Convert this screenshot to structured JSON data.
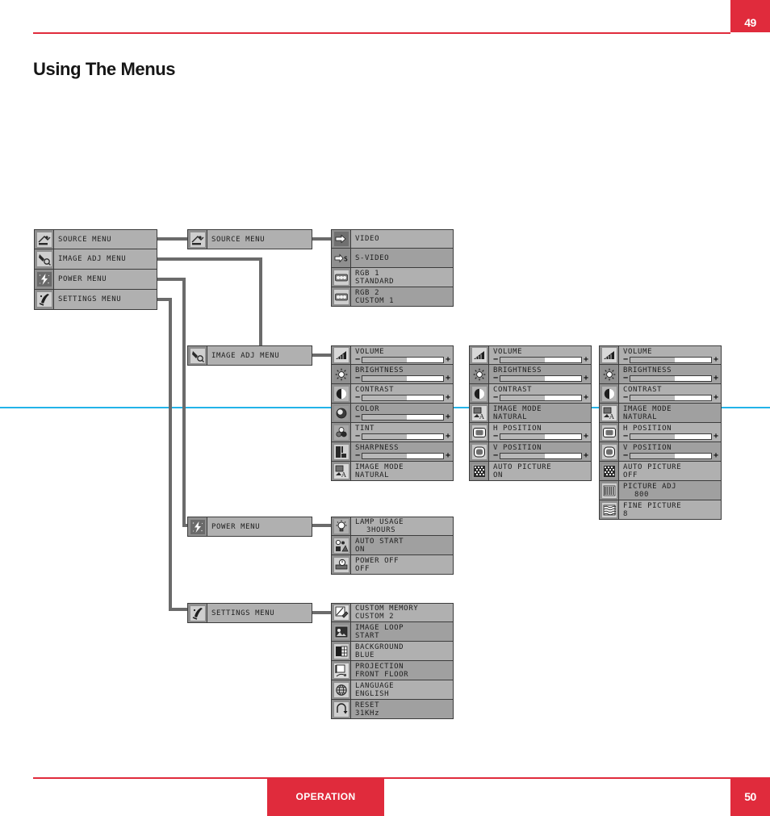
{
  "page": {
    "title": "Using The Menus",
    "page_number_top": "49",
    "page_number_bottom": "50",
    "footer_tab": "OPERATION",
    "accent_color": "#e02b3c",
    "rule_color": "#e02b3c",
    "cyan_line_color": "#22b3e8"
  },
  "diagram": {
    "root_menu": {
      "name": "main-menu",
      "items": [
        {
          "label": "SOURCE MENU",
          "icon": "source-icon"
        },
        {
          "label": "IMAGE ADJ MENU",
          "icon": "image-adj-icon"
        },
        {
          "label": "POWER MENU",
          "icon": "power-icon"
        },
        {
          "label": "SETTINGS MENU",
          "icon": "settings-icon"
        }
      ]
    },
    "source_menu": {
      "header": {
        "label": "SOURCE MENU",
        "icon": "source-icon"
      },
      "items": [
        {
          "label": "VIDEO",
          "value": "",
          "icon": "arrow-in-icon"
        },
        {
          "label": "S-VIDEO",
          "value": "",
          "icon": "arrow-s-icon"
        },
        {
          "label": "RGB 1",
          "value": "STANDARD",
          "icon": "rgb-dots-icon"
        },
        {
          "label": "RGB 2",
          "value": "CUSTOM 1",
          "icon": "rgb-dots-icon"
        }
      ]
    },
    "image_adj_menu": {
      "header": {
        "label": "IMAGE ADJ MENU",
        "icon": "image-adj-icon"
      },
      "video_items": [
        {
          "label": "VOLUME",
          "type": "slider",
          "fill": 55,
          "icon": "volume-icon"
        },
        {
          "label": "BRIGHTNESS",
          "type": "slider",
          "fill": 55,
          "icon": "brightness-icon"
        },
        {
          "label": "CONTRAST",
          "type": "slider",
          "fill": 55,
          "icon": "contrast-icon"
        },
        {
          "label": "COLOR",
          "type": "slider",
          "fill": 55,
          "icon": "color-icon"
        },
        {
          "label": "TINT",
          "type": "slider",
          "fill": 55,
          "icon": "tint-icon"
        },
        {
          "label": "SHARPNESS",
          "type": "slider",
          "fill": 55,
          "icon": "sharpness-icon"
        },
        {
          "label": "IMAGE MODE",
          "type": "value",
          "value": "NATURAL",
          "icon": "image-mode-icon"
        }
      ],
      "rgb_auto_items": [
        {
          "label": "VOLUME",
          "type": "slider",
          "fill": 55,
          "icon": "volume-icon"
        },
        {
          "label": "BRIGHTNESS",
          "type": "slider",
          "fill": 55,
          "icon": "brightness-icon"
        },
        {
          "label": "CONTRAST",
          "type": "slider",
          "fill": 55,
          "icon": "contrast-icon"
        },
        {
          "label": "IMAGE MODE",
          "type": "value",
          "value": "NATURAL",
          "icon": "image-mode-icon"
        },
        {
          "label": "H POSITION",
          "type": "slider",
          "fill": 55,
          "icon": "h-position-icon"
        },
        {
          "label": "V POSITION",
          "type": "slider",
          "fill": 55,
          "icon": "v-position-icon"
        },
        {
          "label": "AUTO PICTURE",
          "type": "value",
          "value": "ON",
          "icon": "auto-picture-icon"
        }
      ],
      "rgb_manual_items": [
        {
          "label": "VOLUME",
          "type": "slider",
          "fill": 55,
          "icon": "volume-icon"
        },
        {
          "label": "BRIGHTNESS",
          "type": "slider",
          "fill": 55,
          "icon": "brightness-icon"
        },
        {
          "label": "CONTRAST",
          "type": "slider",
          "fill": 55,
          "icon": "contrast-icon"
        },
        {
          "label": "IMAGE MODE",
          "type": "value",
          "value": "NATURAL",
          "icon": "image-mode-icon"
        },
        {
          "label": "H POSITION",
          "type": "slider",
          "fill": 55,
          "icon": "h-position-icon"
        },
        {
          "label": "V POSITION",
          "type": "slider",
          "fill": 55,
          "icon": "v-position-icon"
        },
        {
          "label": "AUTO PICTURE",
          "type": "value",
          "value": "OFF",
          "icon": "auto-picture-icon"
        },
        {
          "label": "PICTURE ADJ",
          "type": "value",
          "value": "800",
          "icon": "picture-adj-icon"
        },
        {
          "label": "FINE PICTURE",
          "type": "value",
          "value": "8",
          "icon": "fine-picture-icon"
        }
      ]
    },
    "power_menu": {
      "header": {
        "label": "POWER MENU",
        "icon": "power-icon"
      },
      "items": [
        {
          "label": "LAMP USAGE",
          "value": "3HOURS",
          "icon": "lamp-icon"
        },
        {
          "label": "AUTO START",
          "value": "ON",
          "icon": "auto-start-icon"
        },
        {
          "label": "POWER OFF",
          "value": "OFF",
          "icon": "power-off-icon"
        }
      ]
    },
    "settings_menu": {
      "header": {
        "label": "SETTINGS MENU",
        "icon": "settings-icon"
      },
      "items": [
        {
          "label": "CUSTOM MEMORY",
          "value": "CUSTOM 2",
          "icon": "custom-memory-icon"
        },
        {
          "label": "IMAGE LOOP",
          "value": "START",
          "icon": "image-loop-icon"
        },
        {
          "label": "BACKGROUND",
          "value": "BLUE",
          "icon": "background-icon"
        },
        {
          "label": "PROJECTION",
          "value": "FRONT FLOOR",
          "icon": "projection-icon"
        },
        {
          "label": "LANGUAGE",
          "value": "ENGLISH",
          "icon": "language-icon"
        },
        {
          "label": "RESET",
          "value": "31KHz",
          "icon": "reset-icon"
        }
      ]
    }
  }
}
